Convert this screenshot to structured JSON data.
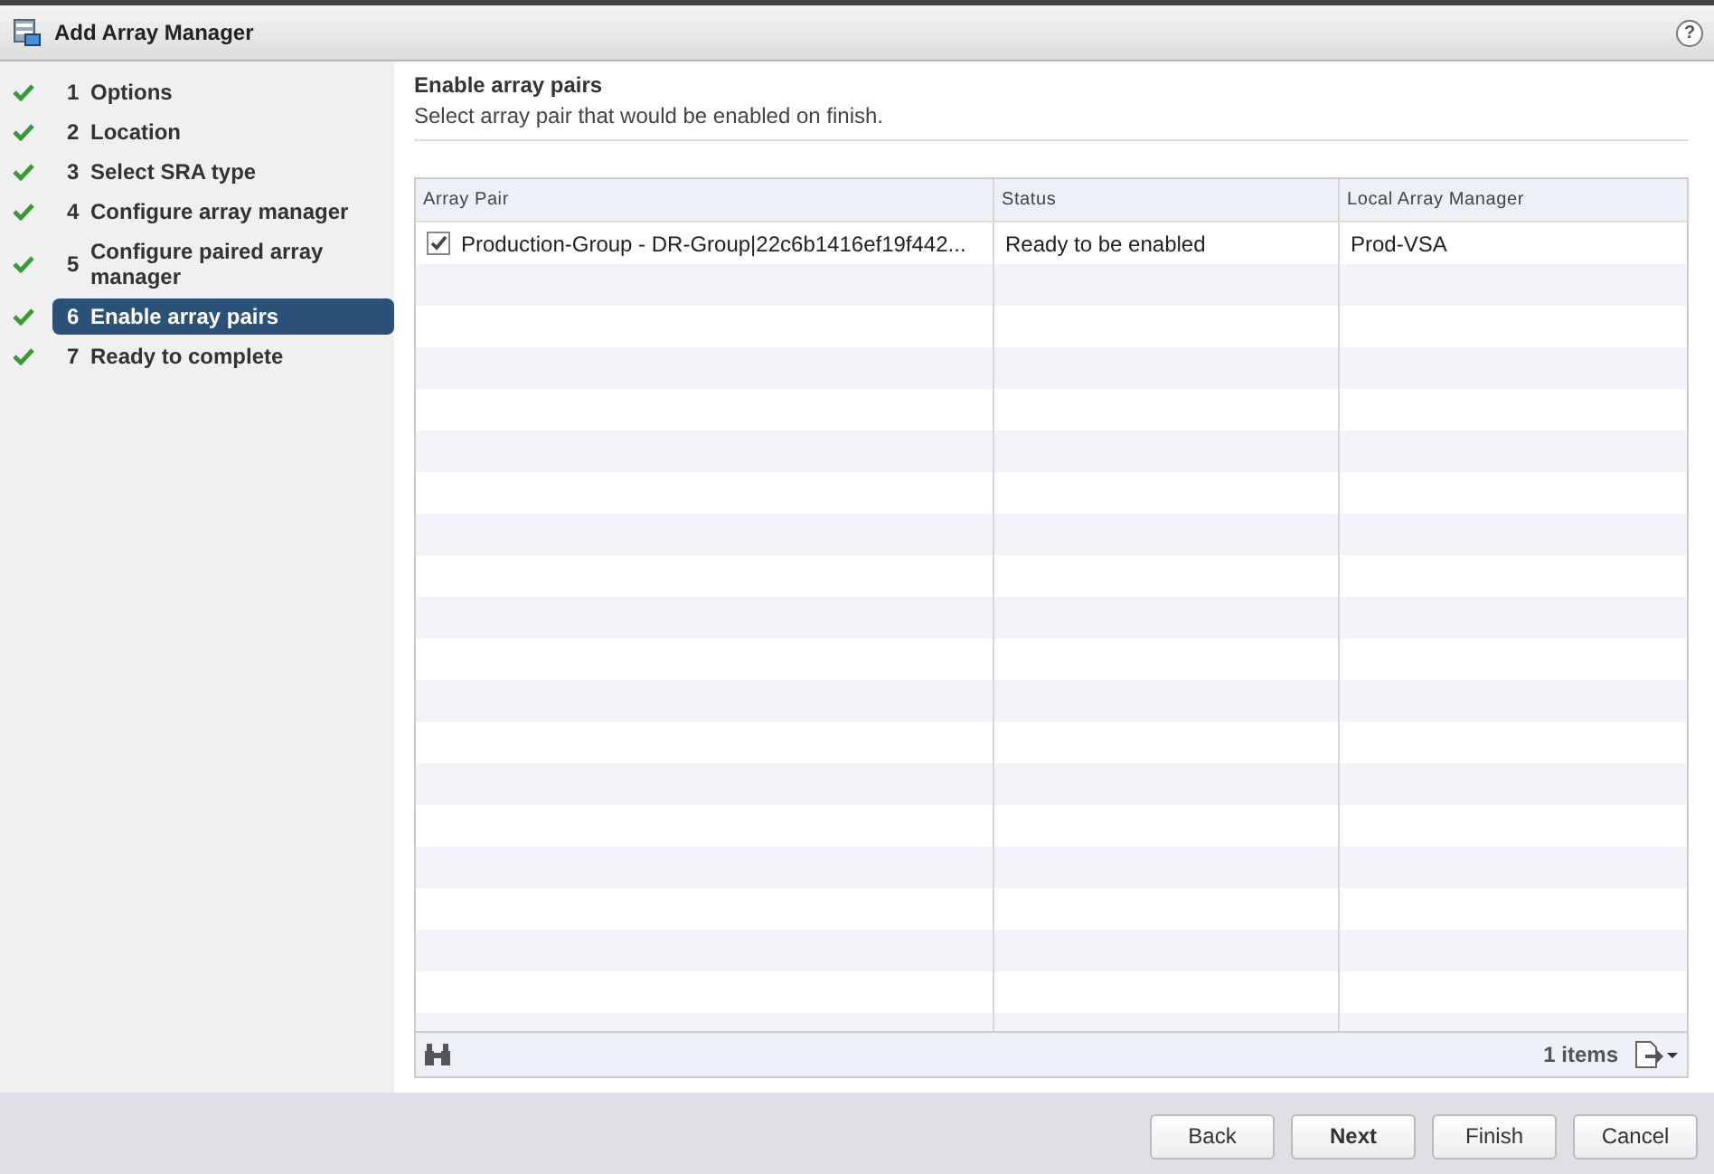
{
  "window": {
    "title": "Add Array Manager",
    "help": "?"
  },
  "steps": [
    {
      "number": "1",
      "label": "Options",
      "completed": true,
      "selected": false
    },
    {
      "number": "2",
      "label": "Location",
      "completed": true,
      "selected": false
    },
    {
      "number": "3",
      "label": "Select SRA type",
      "completed": true,
      "selected": false
    },
    {
      "number": "4",
      "label": "Configure array manager",
      "completed": true,
      "selected": false
    },
    {
      "number": "5",
      "label": "Configure paired array manager",
      "completed": true,
      "selected": false
    },
    {
      "number": "6",
      "label": "Enable array pairs",
      "completed": true,
      "selected": true
    },
    {
      "number": "7",
      "label": "Ready to complete",
      "completed": true,
      "selected": false
    }
  ],
  "page": {
    "title": "Enable array pairs",
    "description": "Select array pair that would be enabled on finish."
  },
  "table": {
    "columns": [
      "Array Pair",
      "Status",
      "Local Array Manager"
    ],
    "rows": [
      {
        "checked": true,
        "cells": [
          "Production-Group - DR-Group|22c6b1416ef19f442...",
          "Ready to be enabled",
          "Prod-VSA"
        ]
      }
    ],
    "count": "1 items"
  },
  "buttons": [
    {
      "label": "Back",
      "default": false
    },
    {
      "label": "Next",
      "default": true
    },
    {
      "label": "Finish",
      "default": false
    },
    {
      "label": "Cancel",
      "default": false
    }
  ]
}
